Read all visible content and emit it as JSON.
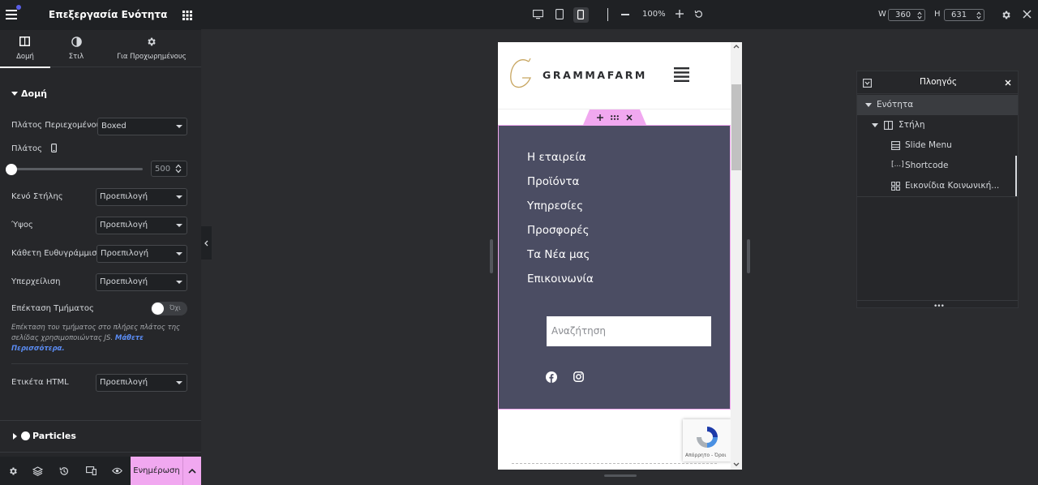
{
  "panel": {
    "title": "Επεξεργασία Ενότητα",
    "tabs": [
      {
        "label": "Δομή"
      },
      {
        "label": "Στιλ"
      },
      {
        "label": "Για Προχωρημένους"
      }
    ],
    "section_title": "Δομή",
    "content_width_label": "Πλάτος Περιεχομένου",
    "content_width_value": "Boxed",
    "width_label": "Πλάτος",
    "width_value": "500",
    "column_gap_label": "Κενό Στήλης",
    "column_gap_value": "Προεπιλογή",
    "height_label": "Ύψος",
    "height_value": "Προεπιλογή",
    "vertical_align_label": "Κάθετη Ευθυγράμμιση",
    "vertical_align_value": "Προεπιλογή",
    "overflow_label": "Υπερχείλιση",
    "overflow_value": "Προεπιλογή",
    "stretch_label": "Επέκταση Τμήματος",
    "stretch_toggle": "Όχι",
    "stretch_help": "Επέκταση του τμήματος στο πλήρες πλάτος της σελίδας χρησιμοποιώντας JS.",
    "stretch_help_link": "Μάθετε Περισσότερα.",
    "html_tag_label": "Ετικέτα HTML",
    "html_tag_value": "Προεπιλογή",
    "particles_title": "Particles",
    "update_label": "Ενημέρωση"
  },
  "topbar": {
    "zoom": "100%",
    "w_label": "W",
    "w_value": "360",
    "h_label": "H",
    "h_value": "631"
  },
  "preview": {
    "brand": "GRAMMAFARM",
    "menu": [
      "Η εταιρεία",
      "Προϊόντα",
      "Υπηρεσίες",
      "Προσφορές",
      "Τα Νέα μας",
      "Επικοινωνία"
    ],
    "search_placeholder": "Αναζήτηση",
    "recaptcha_text": "Απόρρητο - Όροι"
  },
  "navigator": {
    "title": "Πλοηγός",
    "items": [
      {
        "label": "Ενότητα"
      },
      {
        "label": "Στήλη"
      },
      {
        "label": "Slide Menu"
      },
      {
        "label": "Shortcode"
      },
      {
        "label": "Εικονίδια Κοινωνική..."
      }
    ]
  },
  "colors": {
    "accent": "#f1a8f0",
    "section_bg": "#4b4d63",
    "panel_bg": "#26272a",
    "link_blue": "#5b8df5"
  }
}
